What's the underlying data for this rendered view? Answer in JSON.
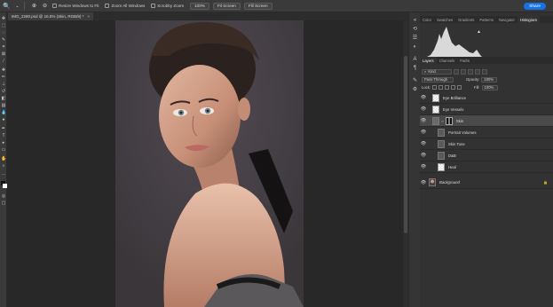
{
  "options_bar": {
    "resize_windows_label": "Resize Windows to Fit",
    "zoom_all_label": "Zoom All Windows",
    "scrubby_zoom_label": "Scrubby Zoom",
    "zoom_value": "100%",
    "fit_screen_label": "Fit Screen",
    "fill_screen_label": "Fill Screen",
    "share_label": "Share"
  },
  "document": {
    "tab_title": "IMG_2280.psd @ 16.5% (Skin, RGB/8) *"
  },
  "top_panel": {
    "tabs": [
      "Color",
      "Swatches",
      "Gradients",
      "Patterns",
      "Navigator",
      "Histogram"
    ],
    "active_tab": "Histogram"
  },
  "layers_panel": {
    "tabs": [
      "Layers",
      "Channels",
      "Paths"
    ],
    "active_tab": "Layers",
    "filter_kind": "Kind",
    "blend_mode": "Pass Through",
    "opacity_label": "Opacity:",
    "opacity": "100%",
    "lock_label": "Lock:",
    "fill_label": "Fill:",
    "fill": "100%",
    "layers": [
      {
        "name": "Eye Brilliance",
        "thumb": "checker",
        "selected": false,
        "italic": false
      },
      {
        "name": "Eye Vessels",
        "thumb": "checker",
        "selected": false,
        "italic": false
      },
      {
        "name": "Skin",
        "thumb": "mask",
        "selected": true,
        "italic": false
      },
      {
        "name": "Portrait Volumes",
        "thumb": "gray",
        "selected": false,
        "italic": false
      },
      {
        "name": "Skin Tone",
        "thumb": "gray",
        "selected": false,
        "italic": false
      },
      {
        "name": "D&B",
        "thumb": "gray",
        "selected": false,
        "italic": false
      },
      {
        "name": "Heal",
        "thumb": "checker",
        "selected": false,
        "italic": false
      },
      {
        "name": "Background",
        "thumb": "photo",
        "selected": false,
        "italic": true
      }
    ]
  },
  "colors": {
    "accent": "#1473e6",
    "panel_bg": "#323232",
    "canvas_bg": "#282828"
  }
}
